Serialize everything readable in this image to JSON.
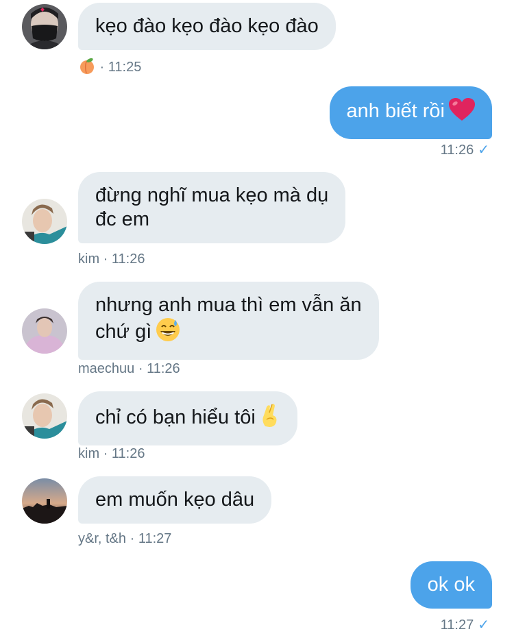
{
  "conversation": {
    "messages": [
      {
        "direction": "in",
        "text": "kẹo đào kẹo đào kẹo đào",
        "meta_emoji": "peach",
        "time": "11:25",
        "avatar": "masked-user"
      },
      {
        "direction": "out",
        "text": "anh biết rồi",
        "emoji": "red-heart",
        "time": "11:26",
        "status": "read"
      },
      {
        "direction": "in",
        "text": "đừng nghĩ mua kẹo mà dụ\nđc em",
        "sender": "kim",
        "time": "11:26",
        "avatar": "kim"
      },
      {
        "direction": "in",
        "text": "nhưng anh mua thì em vẫn ăn\nchứ gì",
        "emoji": "grinning-sweat",
        "sender": "maechuu",
        "time": "11:26",
        "avatar": "maechuu"
      },
      {
        "direction": "in",
        "text": "chỉ có bạn hiểu tôi",
        "emoji": "crossed-fingers",
        "sender": "kim",
        "time": "11:26",
        "avatar": "kim"
      },
      {
        "direction": "in",
        "text": "em muốn kẹo dâu",
        "sender": "y&r, t&h",
        "time": "11:27",
        "avatar": "sunset"
      },
      {
        "direction": "out",
        "text": "ok ok",
        "time": "11:27",
        "status": "read"
      }
    ],
    "separator": " · "
  },
  "colors": {
    "incoming_bubble": "#e6ecf0",
    "outgoing_bubble": "#4ca3ea",
    "meta_text": "#657786",
    "check": "#4ca3ea"
  }
}
